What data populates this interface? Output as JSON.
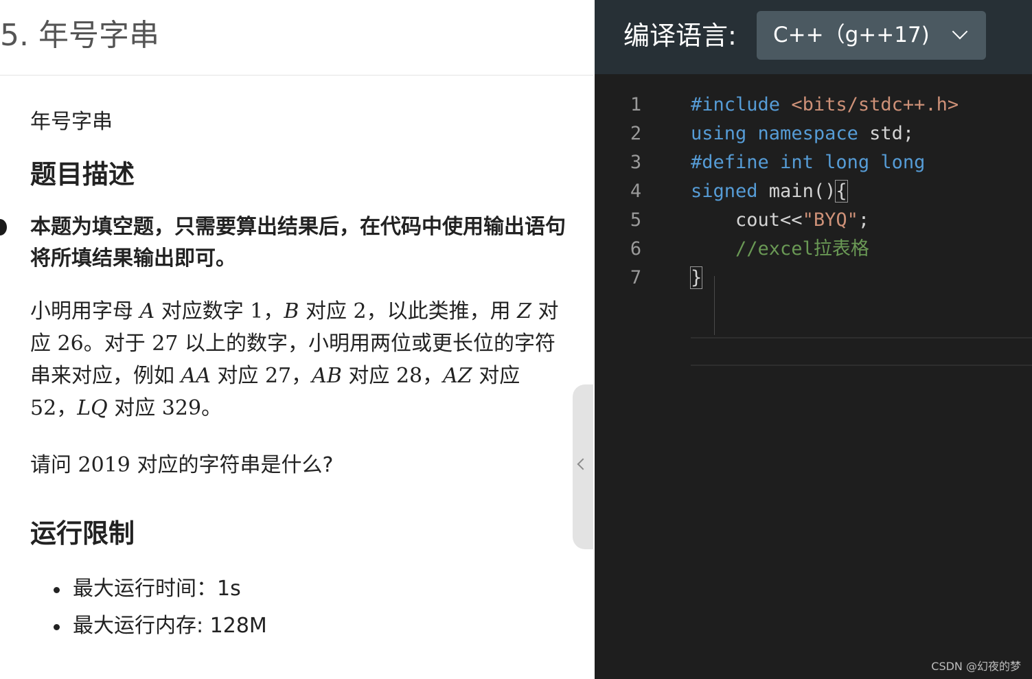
{
  "problem": {
    "title": "5. 年号字串",
    "subtitle": "年号字串",
    "description_heading": "题目描述",
    "fill_note": "本题为填空题，只需要算出结果后，在代码中使用输出语句将所填结果输出即可。",
    "paragraph": {
      "s1": "小明用字母 ",
      "v_A": "A",
      "s2": " 对应数字 ",
      "n_1": "1",
      "s3": "，",
      "v_B": "B",
      "s4": " 对应 ",
      "n_2": "2",
      "s5": "，以此类推，用 ",
      "v_Z": "Z",
      "s6": " 对应 ",
      "n_26": "26",
      "s7": "。对于 ",
      "n_27a": "27",
      "s8": " 以上的数字，小明用两位或更长位的字符串来对应，例如 ",
      "v_AA": "AA",
      "s9": " 对应 ",
      "n_27b": "27",
      "s10": "，",
      "v_AB": "AB",
      "s11": " 对应 ",
      "n_28": "28",
      "s12": "，",
      "v_AZ": "AZ",
      "s13": " 对应 ",
      "n_52": "52",
      "s14": "，",
      "v_LQ": "LQ",
      "s15": " 对应 ",
      "n_329": "329",
      "s16": "。"
    },
    "question": {
      "s1": "请问 ",
      "n_2019": "2019",
      "s2": " 对应的字符串是什么?"
    },
    "limits_heading": "运行限制",
    "limits": [
      "最大运行时间：1s",
      "最大运行内存: 128M"
    ]
  },
  "editor": {
    "language_label": "编译语言:",
    "language_value": "C++（g++17)",
    "lines": {
      "l1": {
        "num": "1",
        "directive": "#include",
        "sp": " ",
        "header": "<bits/stdc++.h>"
      },
      "l2": {
        "num": "2",
        "kw1": "using",
        "sp1": " ",
        "kw2": "namespace",
        "rest": " std;"
      },
      "l3": {
        "num": "3",
        "kw1": "#define",
        "sp1": " ",
        "kw2": "int",
        "sp2": " ",
        "kw3": "long",
        "sp3": " ",
        "kw4": "long"
      },
      "l4": {
        "num": "4",
        "kw1": "signed",
        "rest": " main()",
        "brace": "{"
      },
      "l5": {
        "num": "5",
        "indent": "    ",
        "pre": "cout<<",
        "str": "\"BYQ\"",
        "post": ";"
      },
      "l6": {
        "num": "6",
        "indent": "    ",
        "comment": "//excel拉表格"
      },
      "l7": {
        "num": "7",
        "brace": "}"
      }
    }
  },
  "watermark": "CSDN @幻夜的梦",
  "colors": {
    "editor_bg": "#1e1e1e",
    "header_bg": "#273036",
    "select_bg": "#4b5961",
    "keyword": "#569cd6",
    "string": "#ce9178",
    "comment": "#6a9955"
  }
}
